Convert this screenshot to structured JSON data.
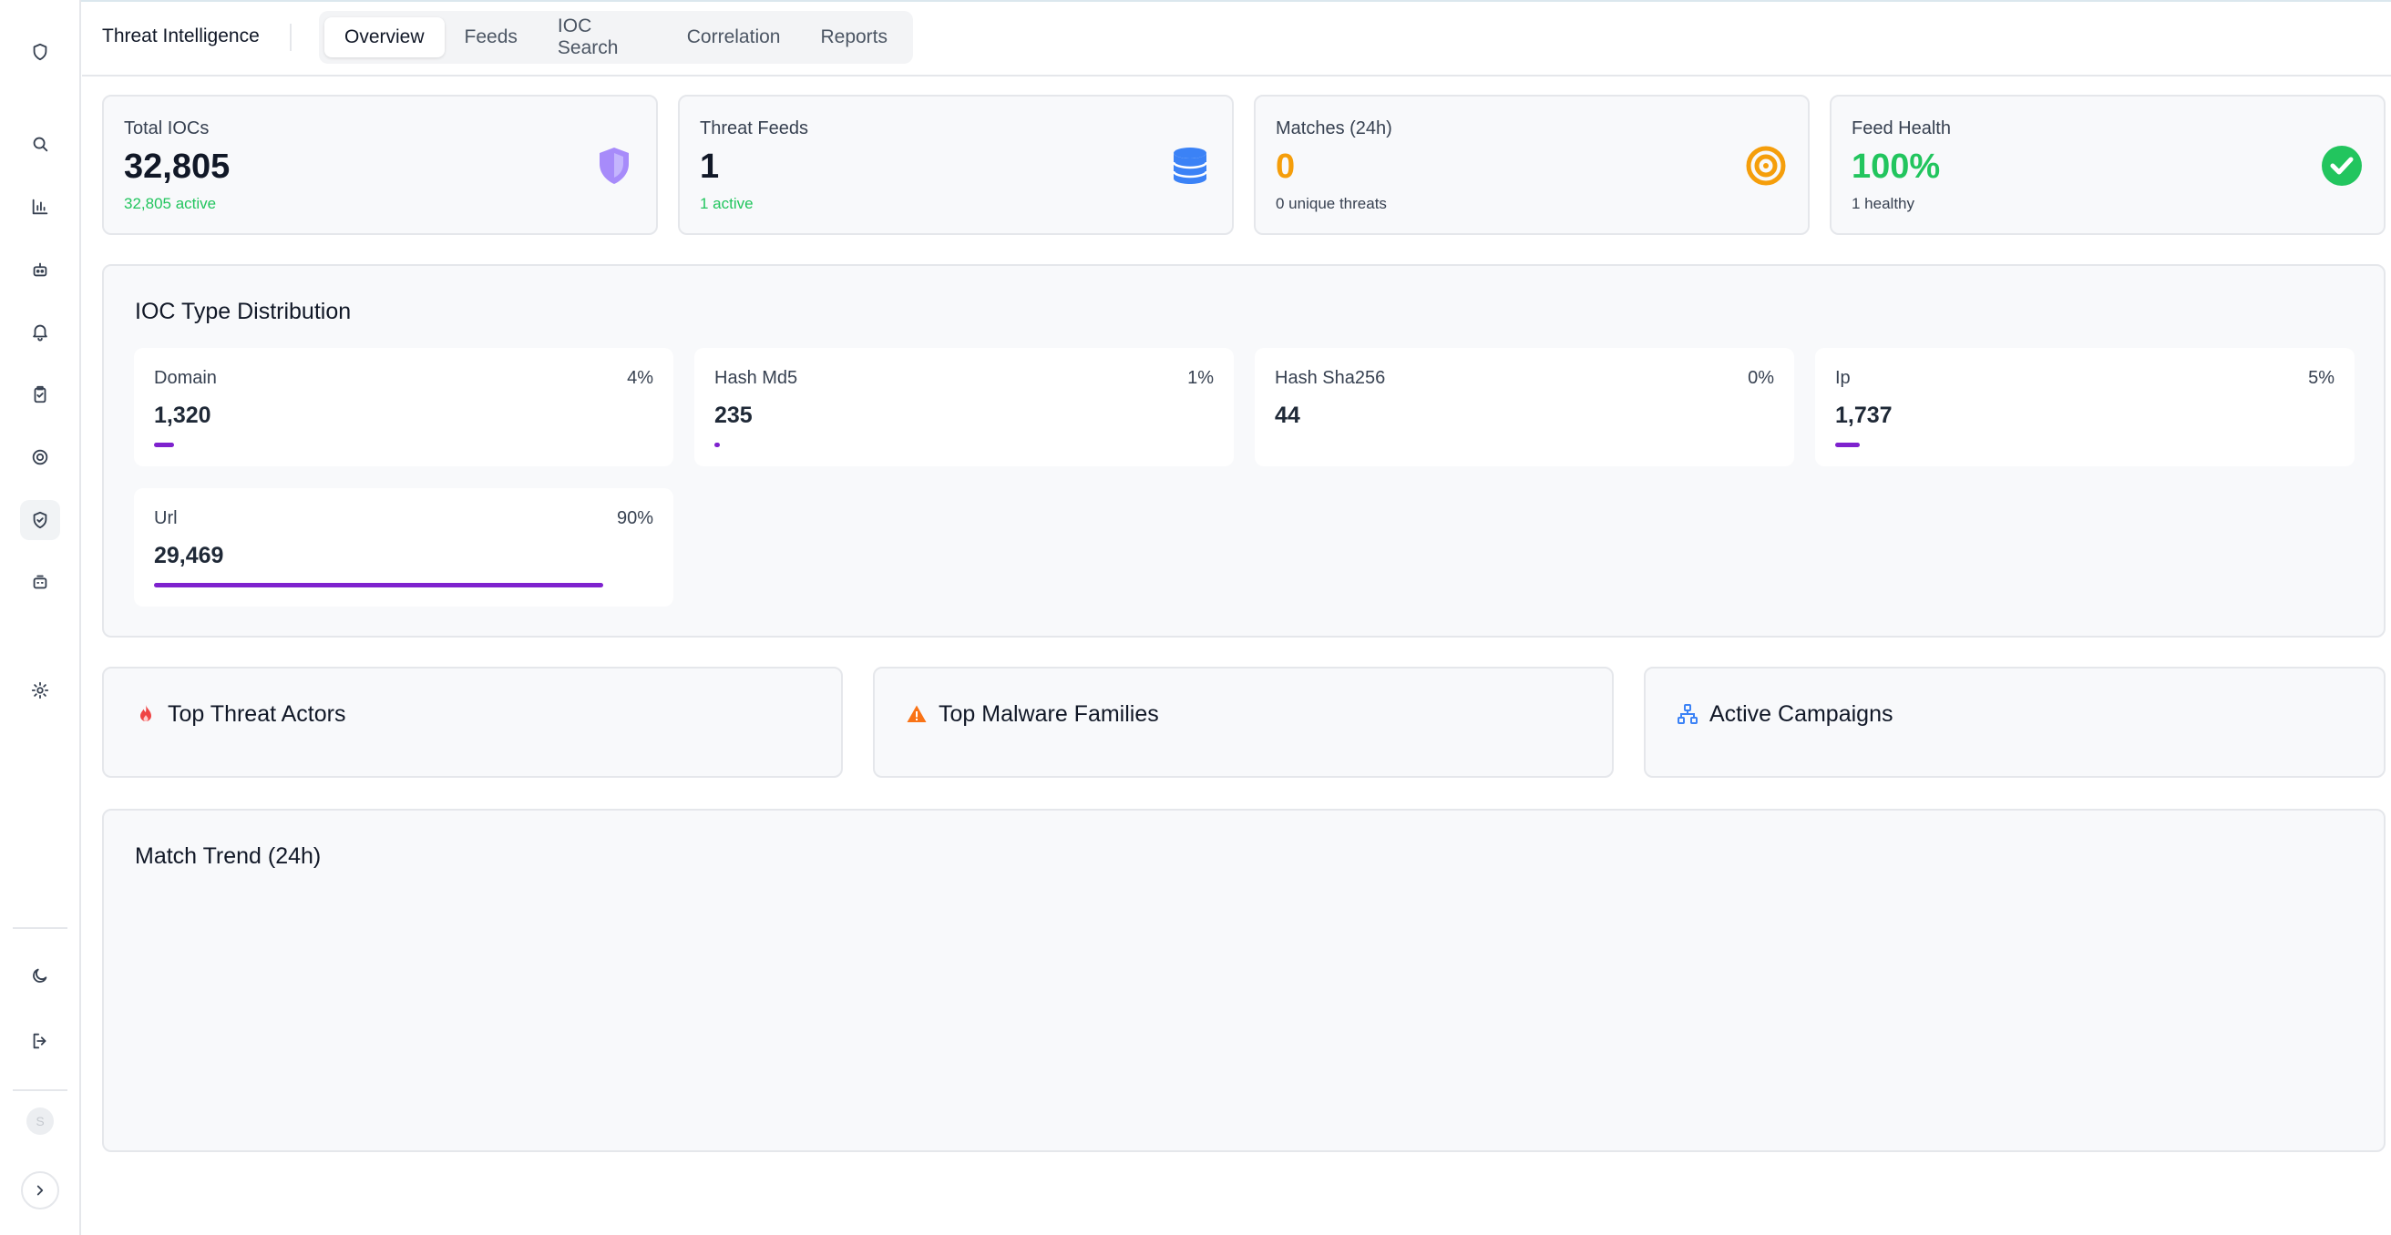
{
  "header": {
    "title": "Threat Intelligence",
    "tabs": [
      {
        "label": "Overview",
        "active": true
      },
      {
        "label": "Feeds",
        "active": false
      },
      {
        "label": "IOC Search",
        "active": false
      },
      {
        "label": "Correlation",
        "active": false
      },
      {
        "label": "Reports",
        "active": false
      }
    ]
  },
  "sidebar": {
    "items": [
      {
        "icon": "shield-logo-icon"
      },
      {
        "icon": "search-icon"
      },
      {
        "icon": "bar-chart-icon"
      },
      {
        "icon": "robot-icon"
      },
      {
        "icon": "bell-icon"
      },
      {
        "icon": "clipboard-check-icon"
      },
      {
        "icon": "target-icon"
      },
      {
        "icon": "shield-check-icon",
        "active": true
      },
      {
        "icon": "bot-icon"
      },
      {
        "icon": "settings-icon"
      },
      {
        "icon": "moon-icon"
      },
      {
        "icon": "logout-icon"
      },
      {
        "icon": "chevron-right-icon"
      }
    ],
    "avatar_initial": "S"
  },
  "stats": [
    {
      "label": "Total IOCs",
      "value": "32,805",
      "sub": "32,805 active",
      "value_color": "#111827",
      "sub_color": "#22c55e",
      "icon": "shield-icon",
      "icon_color": "#a78bfa"
    },
    {
      "label": "Threat Feeds",
      "value": "1",
      "sub": "1 active",
      "value_color": "#111827",
      "sub_color": "#22c55e",
      "icon": "database-icon",
      "icon_color": "#3b82f6"
    },
    {
      "label": "Matches (24h)",
      "value": "0",
      "sub": "0 unique threats",
      "value_color": "#f59e0b",
      "sub_color": "#374151",
      "icon": "target-icon",
      "icon_color": "#f59e0b"
    },
    {
      "label": "Feed Health",
      "value": "100%",
      "sub": "1 healthy",
      "value_color": "#22c55e",
      "sub_color": "#374151",
      "icon": "check-circle-icon",
      "icon_color": "#22c55e"
    }
  ],
  "ioc_distribution": {
    "title": "IOC Type Distribution",
    "bar_color": "#7e22ce",
    "items": [
      {
        "name": "Domain",
        "percent_label": "4%",
        "count": "1,320",
        "fraction": 0.04
      },
      {
        "name": "Hash Md5",
        "percent_label": "1%",
        "count": "235",
        "fraction": 0.01
      },
      {
        "name": "Hash Sha256",
        "percent_label": "0%",
        "count": "44",
        "fraction": 0.0
      },
      {
        "name": "Ip",
        "percent_label": "5%",
        "count": "1,737",
        "fraction": 0.05
      },
      {
        "name": "Url",
        "percent_label": "90%",
        "count": "29,469",
        "fraction": 0.9
      }
    ]
  },
  "sections": [
    {
      "title": "Top Threat Actors",
      "icon": "flame-icon",
      "icon_color": "#ef4444"
    },
    {
      "title": "Top Malware Families",
      "icon": "warning-triangle-icon",
      "icon_color": "#f97316"
    },
    {
      "title": "Active Campaigns",
      "icon": "network-icon",
      "icon_color": "#3b82f6"
    }
  ],
  "trend": {
    "title": "Match Trend (24h)"
  }
}
